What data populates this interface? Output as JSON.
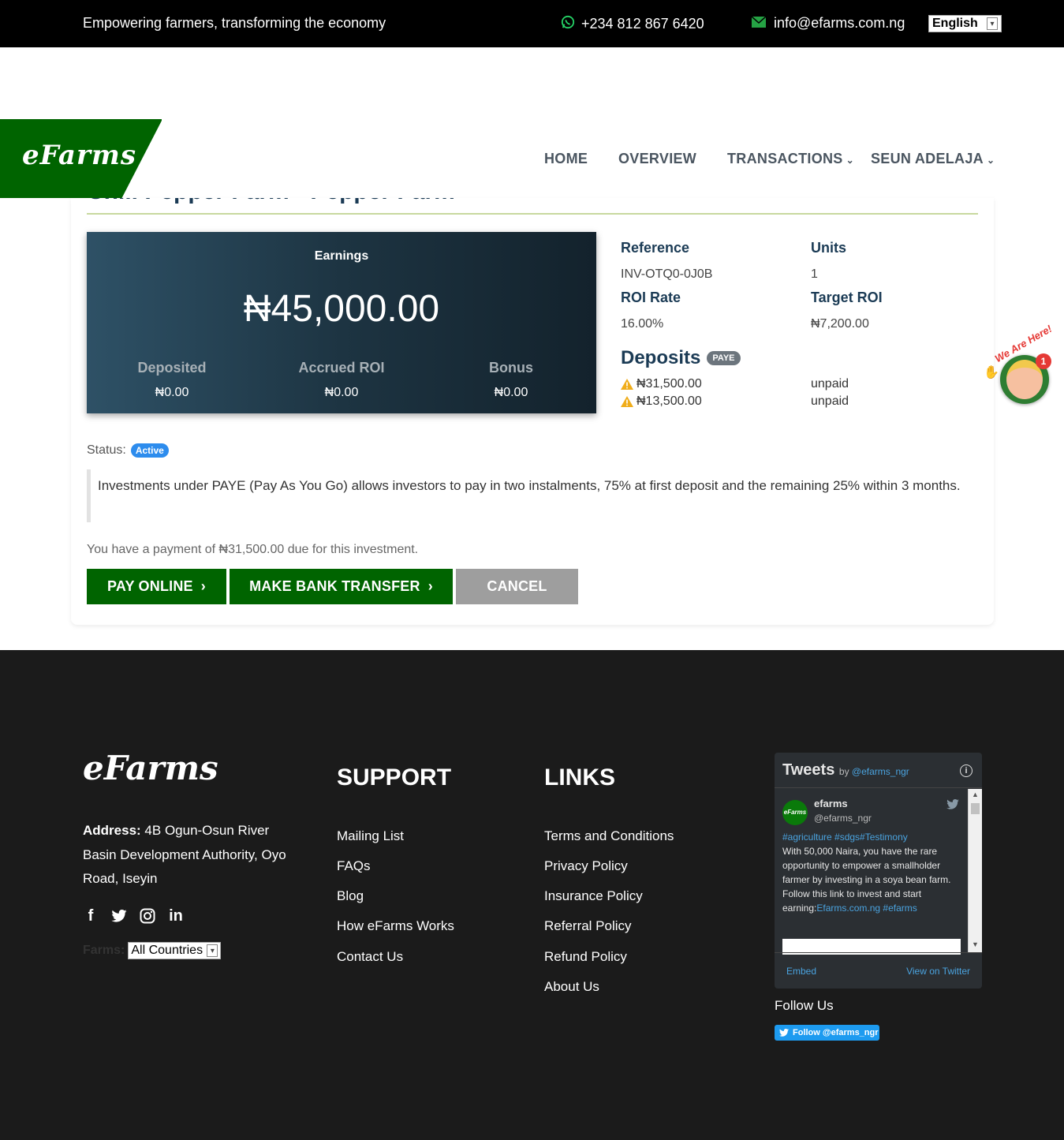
{
  "topbar": {
    "tagline": "Empowering farmers, transforming the economy",
    "phone": "+234 812 867 6420",
    "email": "info@efarms.com.ng",
    "language": "English"
  },
  "brand": {
    "logo": "eFarms",
    "accent": "#006400"
  },
  "nav": {
    "home": "HOME",
    "overview": "OVERVIEW",
    "transactions": "TRANSACTIONS",
    "user": "SEUN ADELAJA"
  },
  "investment": {
    "title": "Chili Pepper Farm - Pepper Farm",
    "earnings": {
      "label": "Earnings",
      "amount": "₦45,000.00",
      "deposited_label": "Deposited",
      "deposited": "₦0.00",
      "accrued_label": "Accrued ROI",
      "accrued": "₦0.00",
      "bonus_label": "Bonus",
      "bonus": "₦0.00"
    },
    "reference_label": "Reference",
    "reference": "INV-OTQ0-0J0B",
    "units_label": "Units",
    "units": "1",
    "roi_rate_label": "ROI Rate",
    "roi_rate": "16.00%",
    "target_roi_label": "Target ROI",
    "target_roi": "₦7,200.00",
    "deposits_label": "Deposits",
    "deposits_badge": "PAYE",
    "deposits": [
      {
        "amount": "₦31,500.00",
        "status": "unpaid"
      },
      {
        "amount": "₦13,500.00",
        "status": "unpaid"
      }
    ],
    "status_label": "Status:",
    "status": "Active",
    "note": "Investments under PAYE (Pay As You Go) allows investors to pay in two instalments, 75% at first deposit and the remaining 25% within 3 months.",
    "due_text": "You have a payment of ₦31,500.00 due for this investment.",
    "buttons": {
      "pay_online": "PAY ONLINE",
      "bank_transfer": "MAKE BANK TRANSFER",
      "cancel": "CANCEL"
    }
  },
  "chat_widget": {
    "tag": "We Are Here!",
    "notifications": "1"
  },
  "footer": {
    "logo": "eFarms",
    "address_label": "Address:",
    "address": "4B Ogun-Osun River Basin Development Authority, Oyo Road, Iseyin",
    "farms_label": "Farms:",
    "farms_select": "All Countries",
    "support_title": "SUPPORT",
    "support_links": [
      "Mailing List",
      "FAQs",
      "Blog",
      "How eFarms Works",
      "Contact Us"
    ],
    "links_title": "LINKS",
    "links": [
      "Terms and Conditions",
      "Privacy Policy",
      "Insurance Policy",
      "Referral Policy",
      "Refund Policy",
      "About Us"
    ],
    "tweets": {
      "title": "Tweets",
      "by": "by",
      "handle_link": "@efarms_ngr",
      "user": "efarms",
      "handle": "@efarms_ngr",
      "avatar_text": "eFarms",
      "hashtags": "#agriculture #sdgs#Testimony",
      "body": "With 50,000 Naira, you have the rare opportunity to empower a smallholder farmer by investing in a soya bean farm. Follow this link to invest and start earning:",
      "link": "Efarms.com.ng #efarms",
      "embed": "Embed",
      "view": "View on Twitter"
    },
    "follow_title": "Follow Us",
    "follow_button": "Follow @efarms_ngr"
  }
}
